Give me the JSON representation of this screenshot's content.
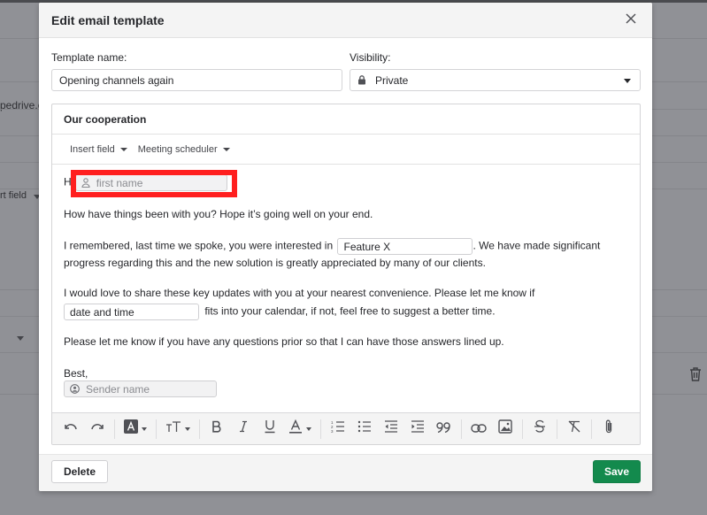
{
  "background": {
    "partial_text_1": "pedrive.c",
    "partial_text_2": "rt field"
  },
  "modal": {
    "title": "Edit email template",
    "close_icon": "close-icon",
    "template_name": {
      "label": "Template name:",
      "value": "Opening channels again"
    },
    "visibility": {
      "label": "Visibility:",
      "value": "Private",
      "icon": "lock-icon"
    },
    "editor": {
      "subject": "Our cooperation",
      "insert_field_label": "Insert field",
      "meeting_scheduler_label": "Meeting scheduler",
      "body": {
        "greeting_prefix": "Hi",
        "first_name_chip": "first name",
        "line_1": "How have things been with you? Hope it’s going well on your end.",
        "line_2_before": "I remembered, last time we spoke, you were interested in",
        "feature_chip": "Feature X",
        "line_2_after": ". We have made significant",
        "line_3": "progress regarding this and the new solution is greatly appreciated by many of our clients.",
        "line_4": "I would love to share these key updates with you at your nearest convenience. Please let me know if",
        "date_chip": "date and time",
        "line_5_after": "fits into your calendar, if not, feel free to suggest a better time.",
        "line_6": "Please let me know if you have any questions prior so that I can have those answers lined up.",
        "signoff": "Best,",
        "sender_chip": "Sender name"
      },
      "toolbar": [
        "undo",
        "redo",
        "text-highlight",
        "font-size",
        "bold",
        "italic",
        "underline",
        "text-color",
        "ordered-list",
        "bullet-list",
        "outdent",
        "indent",
        "blockquote",
        "link",
        "image",
        "strikethrough",
        "clear-format",
        "attachment"
      ]
    },
    "footer": {
      "delete_label": "Delete",
      "save_label": "Save"
    }
  },
  "colors": {
    "save": "#138a4d",
    "highlight_annotation": "#ff1f1f"
  }
}
